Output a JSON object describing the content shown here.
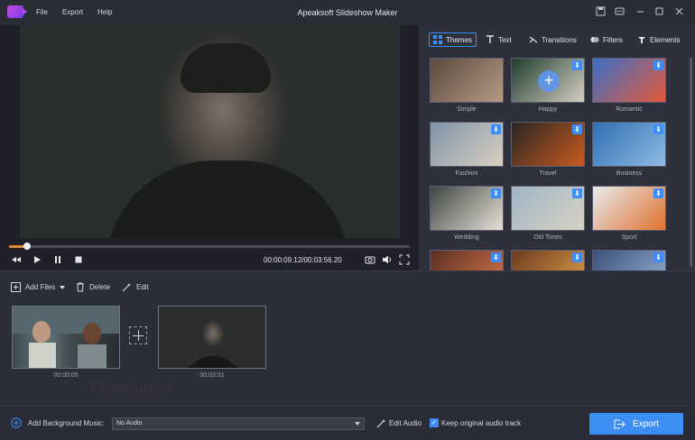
{
  "app": {
    "title": "Apeaksoft Slideshow Maker"
  },
  "menu": {
    "file": "File",
    "export": "Export",
    "help": "Help"
  },
  "player": {
    "progress": 0.045,
    "timecode": "00:00:09.12/00:03:56.20"
  },
  "tabs": [
    {
      "label": "Themes",
      "icon": "grid-icon"
    },
    {
      "label": "Text",
      "icon": "text-icon"
    },
    {
      "label": "Transitions",
      "icon": "transitions-icon"
    },
    {
      "label": "Filters",
      "icon": "filters-icon"
    },
    {
      "label": "Elements",
      "icon": "elements-icon"
    }
  ],
  "themes": [
    {
      "label": "Simple",
      "download": false,
      "colors": [
        "#5b4a3f",
        "#b59a84"
      ]
    },
    {
      "label": "Happy",
      "download": true,
      "colors": [
        "#1f3e2e",
        "#d6cfc2"
      ]
    },
    {
      "label": "Romantic",
      "download": true,
      "colors": [
        "#3b6fc7",
        "#e45a3a"
      ]
    },
    {
      "label": "Fashion",
      "download": true,
      "colors": [
        "#7e93a8",
        "#d9cfc1"
      ]
    },
    {
      "label": "Travel",
      "download": true,
      "colors": [
        "#2a2624",
        "#c95a1f"
      ]
    },
    {
      "label": "Business",
      "download": true,
      "colors": [
        "#2f6fb3",
        "#8fbbe3"
      ]
    },
    {
      "label": "Wedding",
      "download": true,
      "colors": [
        "#3f4640",
        "#e6e1d8"
      ]
    },
    {
      "label": "Old Times",
      "download": true,
      "colors": [
        "#9fb6c7",
        "#d8d2c3"
      ]
    },
    {
      "label": "Sport",
      "download": true,
      "colors": [
        "#e8ecef",
        "#e0702c"
      ]
    },
    {
      "label": "",
      "download": true,
      "colors": [
        "#5a2f24",
        "#d9774a"
      ]
    },
    {
      "label": "",
      "download": true,
      "colors": [
        "#6a3a1c",
        "#e3a24c"
      ]
    },
    {
      "label": "",
      "download": true,
      "colors": [
        "#3b4f7a",
        "#9bb3d6"
      ]
    }
  ],
  "toolbar": {
    "add_files": "Add Files",
    "delete": "Delete",
    "edit": "Edit"
  },
  "clips": [
    {
      "duration": "00:00:05"
    },
    {
      "duration": "00:03:51"
    }
  ],
  "watermark": "Tickcoupon",
  "bottom": {
    "add_music": "Add Background Music:",
    "music_value": "No Audio",
    "edit_audio": "Edit Audio",
    "keep_track": "Keep original audio track",
    "keep_track_checked": true,
    "export": "Export"
  },
  "colors": {
    "accent": "#3d8ef3",
    "seek": "#e28a3a"
  }
}
